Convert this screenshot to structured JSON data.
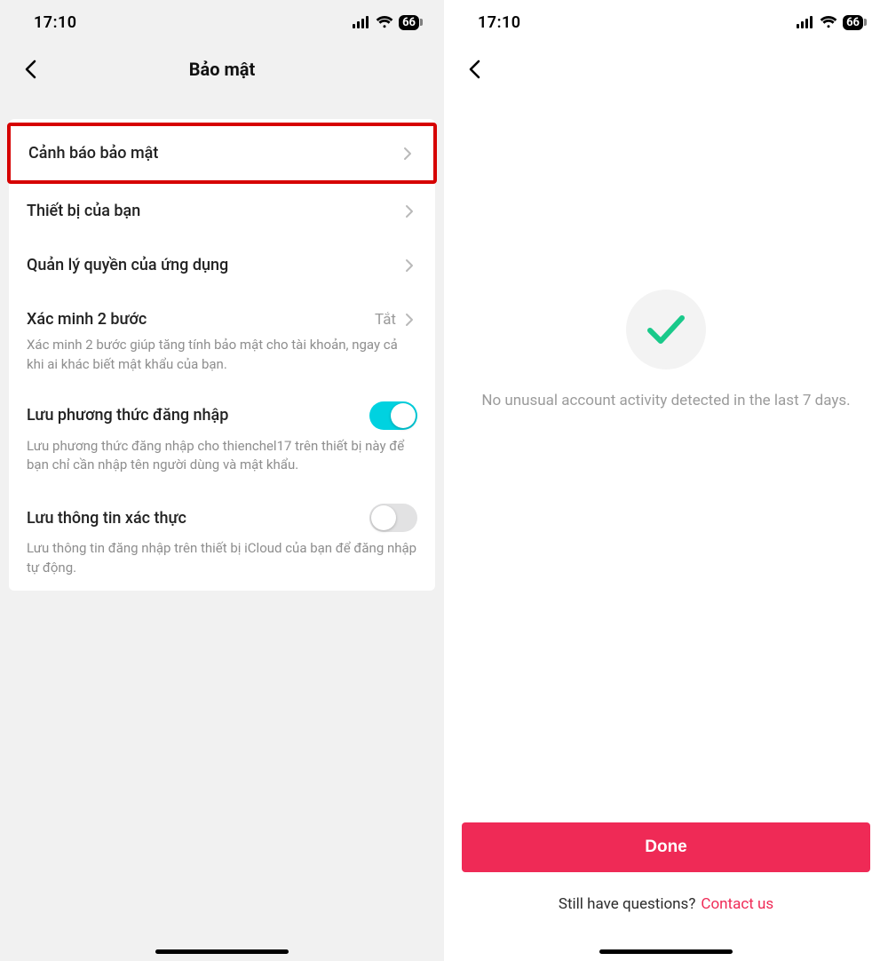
{
  "status": {
    "time": "17:10",
    "battery": "66"
  },
  "left": {
    "title": "Bảo mật",
    "items": {
      "alert": {
        "label": "Cảnh báo bảo mật"
      },
      "devices": {
        "label": "Thiết bị của bạn"
      },
      "perm": {
        "label": "Quản lý quyền của ứng dụng"
      },
      "twostep": {
        "label": "Xác minh 2 bước",
        "value": "Tắt",
        "desc": "Xác minh 2 bước giúp tăng tính bảo mật cho tài khoản, ngay cả khi ai khác biết mật khẩu của bạn."
      },
      "savelogin": {
        "label": "Lưu phương thức đăng nhập",
        "on": true,
        "desc": "Lưu phương thức đăng nhập cho thienchel17 trên thiết bị này để bạn chỉ cần nhập tên người dùng và mật khẩu."
      },
      "creds": {
        "label": "Lưu thông tin xác thực",
        "on": false,
        "desc": "Lưu thông tin đăng nhập trên thiết bị iCloud của bạn để đăng nhập tự động."
      }
    }
  },
  "right": {
    "message": "No unusual account activity detected in the last 7 days.",
    "done": "Done",
    "footer_q": "Still have questions?",
    "footer_link": "Contact us"
  }
}
